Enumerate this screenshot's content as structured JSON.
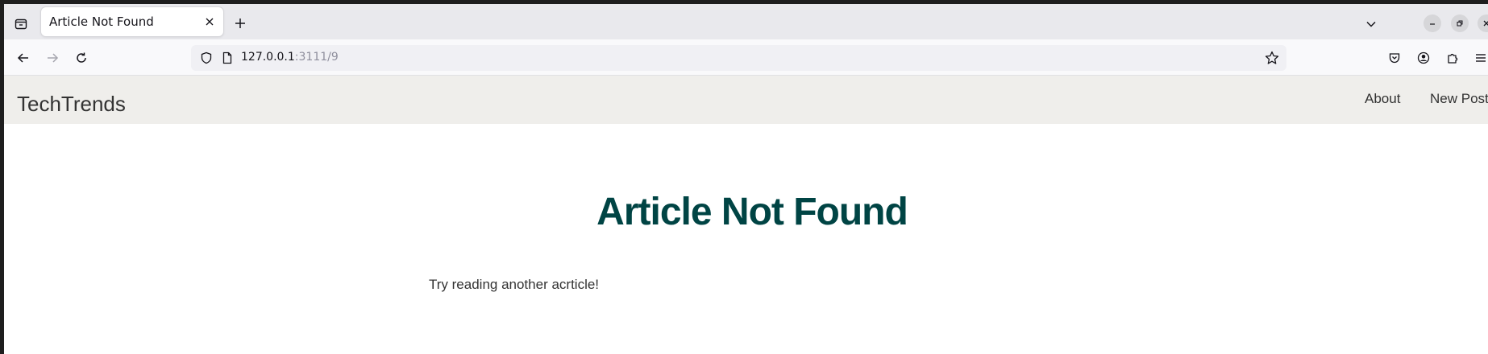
{
  "browser": {
    "tab": {
      "title": "Article Not Found"
    },
    "url": {
      "host": "127.0.0.1",
      "rest": ":3111/9"
    }
  },
  "site": {
    "brand": "TechTrends",
    "nav": [
      {
        "label": "About"
      },
      {
        "label": "New Post"
      }
    ]
  },
  "main": {
    "title": "Article Not Found",
    "message": "Try reading another acrticle!"
  },
  "colors": {
    "title": "#004444",
    "header_bg": "#efeeeb",
    "text": "#333333"
  }
}
